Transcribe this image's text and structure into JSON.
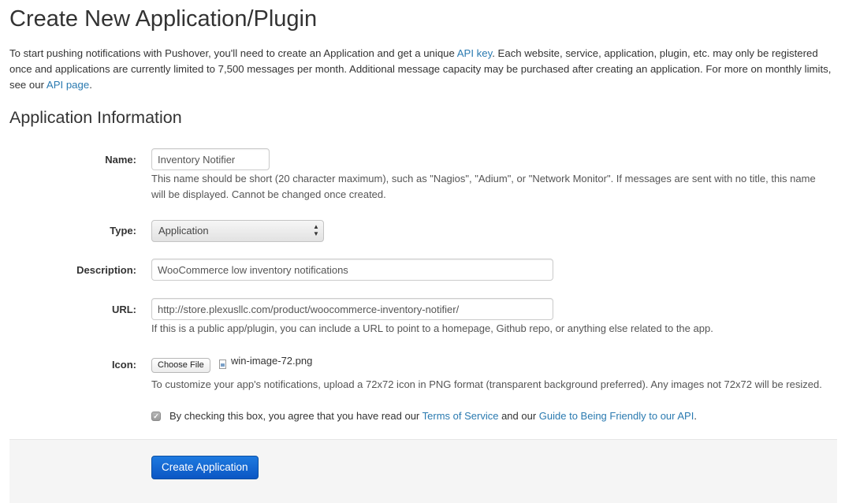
{
  "page": {
    "title": "Create New Application/Plugin",
    "intro": {
      "part1": "To start pushing notifications with Pushover, you'll need to create an Application and get a unique ",
      "api_key_link": "API key",
      "part2": ". Each website, service, application, plugin, etc. may only be registered once and applications are currently limited to 7,500 messages per month. Additional message capacity may be purchased after creating an application. For more on monthly limits, see our ",
      "api_page_link": "API page",
      "part3": "."
    },
    "section_title": "Application Information"
  },
  "form": {
    "name": {
      "label": "Name:",
      "value": "Inventory Notifier",
      "help": "This name should be short (20 character maximum), such as \"Nagios\", \"Adium\", or \"Network Monitor\". If messages are sent with no title, this name will be displayed. Cannot be changed once created."
    },
    "type": {
      "label": "Type:",
      "selected": "Application"
    },
    "description": {
      "label": "Description:",
      "value": "WooCommerce low inventory notifications"
    },
    "url": {
      "label": "URL:",
      "value": "http://store.plexusllc.com/product/woocommerce-inventory-notifier/",
      "help": "If this is a public app/plugin, you can include a URL to point to a homepage, Github repo, or anything else related to the app."
    },
    "icon": {
      "label": "Icon:",
      "button_label": "Choose File",
      "file_name": "win-image-72.png",
      "help": "To customize your app's notifications, upload a 72x72 icon in PNG format (transparent background preferred). Any images not 72x72 will be resized."
    },
    "agreement": {
      "checked": true,
      "text1": "By checking this box, you agree that you have read our ",
      "tos_link": "Terms of Service",
      "text2": " and our ",
      "guide_link": "Guide to Being Friendly to our API",
      "text3": "."
    },
    "submit_label": "Create Application"
  },
  "colors": {
    "link": "#2a7ab0",
    "primary_button": "#1e7ae0"
  }
}
